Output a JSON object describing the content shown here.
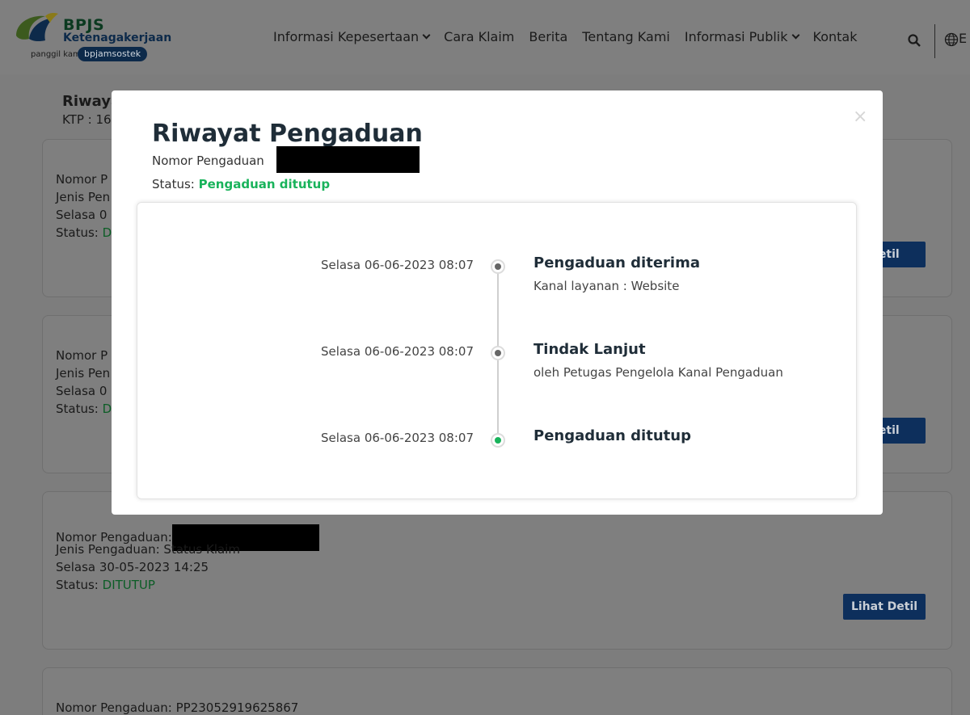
{
  "header": {
    "brand_line1": "BPJS",
    "brand_line2": "Ketenagakerjaan",
    "tagline": "panggil kami",
    "tagline_pill": "bpjamsostek",
    "nav": [
      "Informasi Kepesertaan",
      "Cara Klaim",
      "Berita",
      "Tentang Kami",
      "Informasi Publik",
      "Kontak"
    ],
    "lang": "E",
    "icons": {
      "search": "search-icon",
      "globe": "globe-icon"
    }
  },
  "background": {
    "page_title": "Riwaya",
    "ktp": "KTP : 16",
    "cards": [
      {
        "nomor": "Nomor P",
        "jenis": "Jenis Pen",
        "tanggal": "Selasa 0",
        "status_label": "Status:",
        "status_value": "D",
        "button": "Detil"
      },
      {
        "nomor": "Nomor P",
        "jenis": "Jenis Pen",
        "tanggal": "Selasa 0",
        "status_label": "Status:",
        "status_value": "D",
        "button": "Detil"
      },
      {
        "nomor": "Nomor Pengaduan:",
        "jenis": "Jenis Pengaduan: Status Klaim",
        "tanggal": "Selasa 30-05-2023 14:25",
        "status_label": "Status:",
        "status_value": "DITUTUP",
        "button": "Lihat Detil"
      },
      {
        "nomor": "Nomor Pengaduan: PP23052919625867"
      }
    ]
  },
  "modal": {
    "close": "×",
    "title": "Riwayat Pengaduan",
    "nomor_label": "Nomor Pengaduan",
    "status_label": "Status:",
    "status_value": "Pengaduan ditutup",
    "timeline": [
      {
        "time": "Selasa 06-06-2023 08:07",
        "title": "Pengaduan diterima",
        "detail": "Kanal layanan : Website",
        "dot": "gray"
      },
      {
        "time": "Selasa 06-06-2023 08:07",
        "title": "Tindak Lanjut",
        "detail": "oleh Petugas Pengelola Kanal Pengaduan",
        "dot": "gray"
      },
      {
        "time": "Selasa 06-06-2023 08:07",
        "title": "Pengaduan ditutup",
        "detail": "",
        "dot": "green"
      }
    ]
  },
  "colors": {
    "accent_green": "#19b35b",
    "button_blue": "#0d2f5c",
    "overlay": "#7f7f7f"
  }
}
